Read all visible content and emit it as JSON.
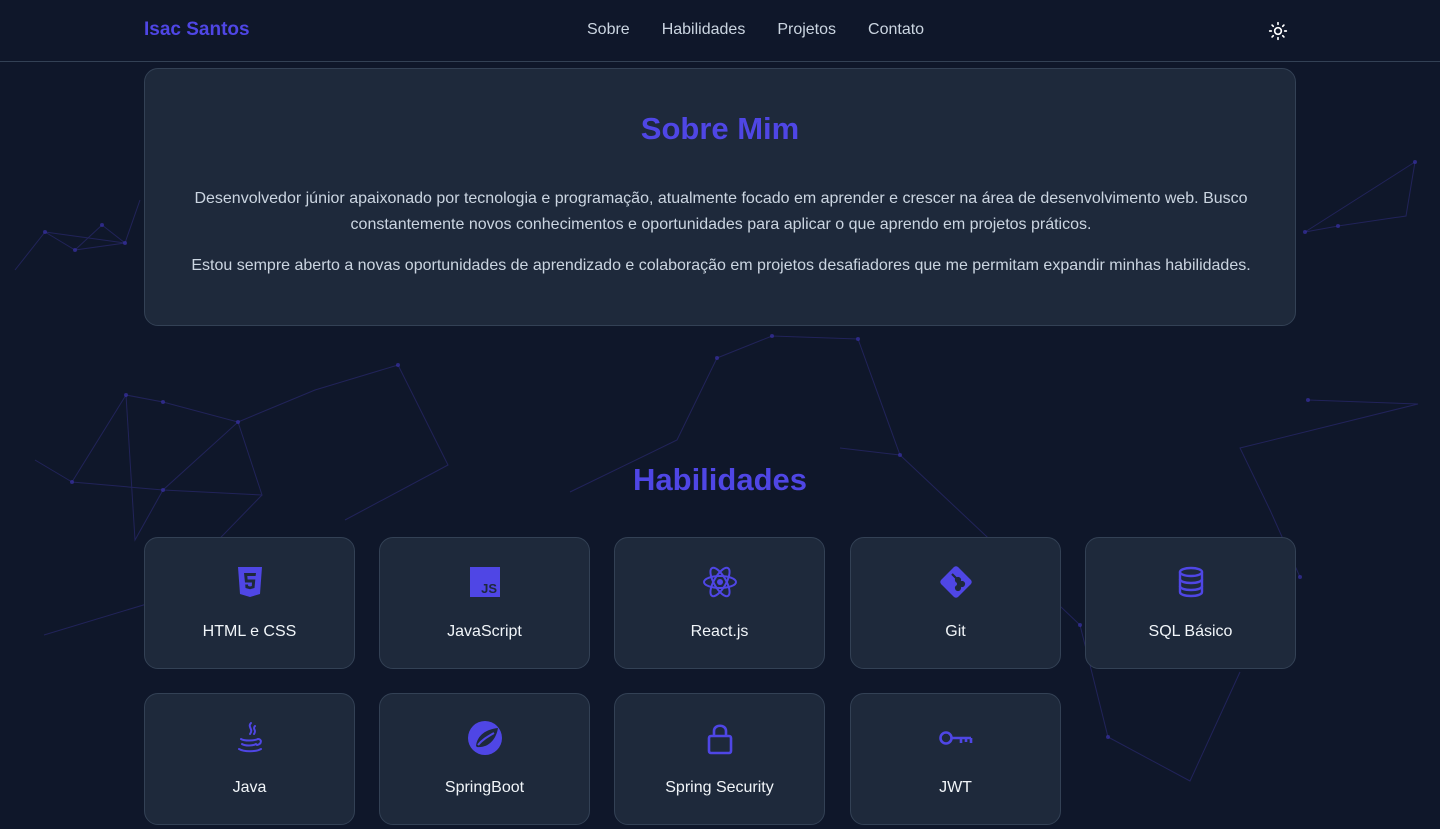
{
  "header": {
    "brand": "Isac Santos",
    "nav": [
      "Sobre",
      "Habilidades",
      "Projetos",
      "Contato"
    ],
    "theme_toggle_icon": "sun-icon"
  },
  "about": {
    "title": "Sobre Mim",
    "paragraph1": "Desenvolvedor júnior apaixonado por tecnologia e programação, atualmente focado em aprender e crescer na área de desenvolvimento web. Busco constantemente novos conhecimentos e oportunidades para aplicar o que aprendo em projetos práticos.",
    "paragraph2": "Estou sempre aberto a novas oportunidades de aprendizado e colaboração em projetos desafiadores que me permitam expandir minhas habilidades."
  },
  "skills": {
    "title": "Habilidades",
    "items": [
      {
        "label": "HTML e CSS",
        "icon": "html5-icon"
      },
      {
        "label": "JavaScript",
        "icon": "javascript-icon"
      },
      {
        "label": "React.js",
        "icon": "react-icon"
      },
      {
        "label": "Git",
        "icon": "git-icon"
      },
      {
        "label": "SQL Básico",
        "icon": "database-icon"
      },
      {
        "label": "Java",
        "icon": "java-icon"
      },
      {
        "label": "SpringBoot",
        "icon": "spring-icon"
      },
      {
        "label": "Spring Security",
        "icon": "lock-icon"
      },
      {
        "label": "JWT",
        "icon": "key-icon"
      }
    ]
  },
  "colors": {
    "background": "#0f172a",
    "card": "#1e293b",
    "accent": "#4f46e5",
    "text": "#cbd5e1"
  }
}
